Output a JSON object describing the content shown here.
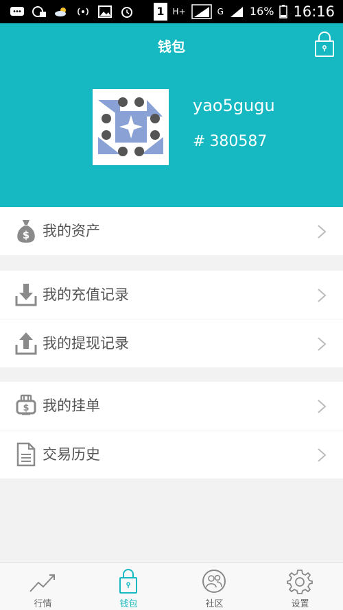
{
  "status_bar": {
    "signal_tag_1": "H+",
    "signal_tag_2": "G",
    "battery": "16%",
    "time": "16:16",
    "sim_label": "1"
  },
  "header": {
    "title": "钱包",
    "username": "yao5gugu",
    "id_prefix": "#",
    "user_id": "380587"
  },
  "sections": [
    {
      "items": [
        {
          "label": "我的资产",
          "icon": "money-bag-icon"
        }
      ]
    },
    {
      "items": [
        {
          "label": "我的充值记录",
          "icon": "download-tray-icon"
        },
        {
          "label": "我的提现记录",
          "icon": "upload-tray-icon"
        }
      ]
    },
    {
      "items": [
        {
          "label": "我的挂单",
          "icon": "order-card-icon"
        },
        {
          "label": "交易历史",
          "icon": "document-icon"
        }
      ]
    }
  ],
  "bottom_nav": [
    {
      "label": "行情",
      "icon": "trend-line-icon",
      "active": false
    },
    {
      "label": "钱包",
      "icon": "lock-icon",
      "active": true
    },
    {
      "label": "社区",
      "icon": "people-icon",
      "active": false
    },
    {
      "label": "设置",
      "icon": "gear-icon",
      "active": false
    }
  ],
  "colors": {
    "accent": "#16b9c1",
    "background": "#f2f2f2",
    "text": "#555555",
    "icon_grey": "#8a8a8a"
  }
}
